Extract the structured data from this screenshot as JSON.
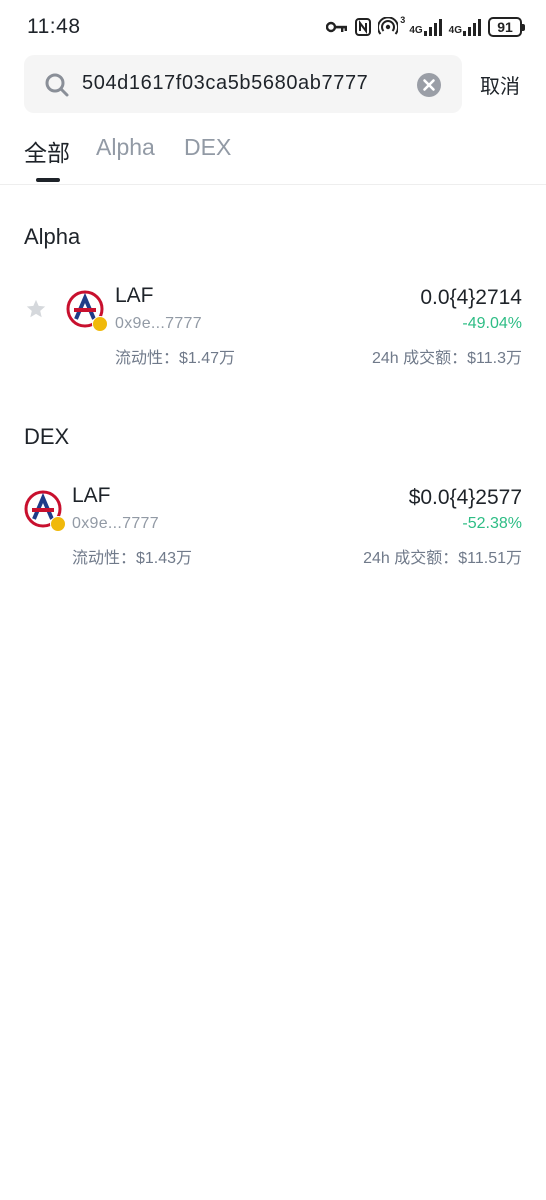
{
  "status_bar": {
    "time": "11:48",
    "sim1_label": "4G",
    "sim2_label": "4G",
    "hotspot_sup": "3",
    "battery": "91"
  },
  "search": {
    "value": "504d1617f03ca5b5680ab7777",
    "cancel_label": "取消"
  },
  "tabs": [
    {
      "label": "全部",
      "active": true
    },
    {
      "label": "Alpha",
      "active": false
    },
    {
      "label": "DEX",
      "active": false
    }
  ],
  "sections": [
    {
      "title": "Alpha",
      "token": {
        "symbol": "LAF",
        "address": "0x9e...7777",
        "liquidity": "流动性：$1.47万",
        "price": "0.0{4}2714",
        "change": "-49.04%",
        "volume": "24h 成交额：$11.3万"
      }
    },
    {
      "title": "DEX",
      "token": {
        "symbol": "LAF",
        "address": "0x9e...7777",
        "liquidity": "流动性：$1.43万",
        "price": "$0.0{4}2577",
        "change": "-52.38%",
        "volume": "24h 成交额：$11.51万"
      }
    }
  ],
  "colors": {
    "positive_change": "#2ebd85",
    "secondary_text": "#929aa5",
    "chain_badge": "#f0b90b",
    "logo_red": "#c8102e",
    "logo_blue": "#1f3c88"
  }
}
